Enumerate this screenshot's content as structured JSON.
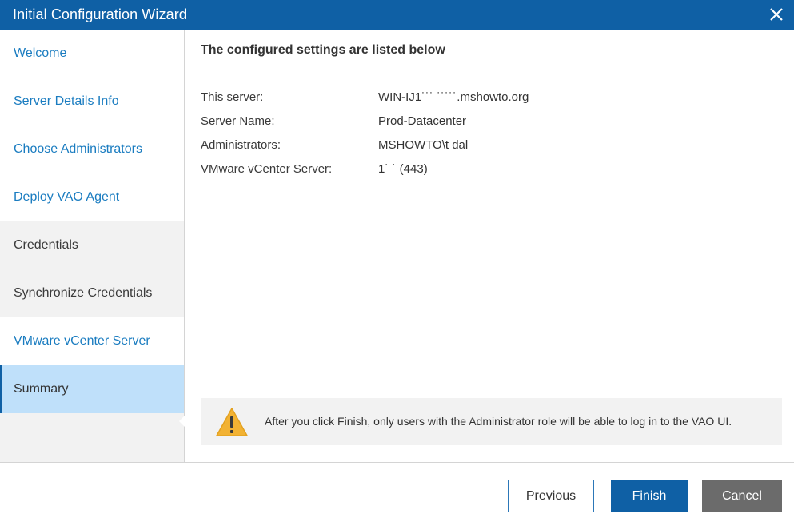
{
  "window": {
    "title": "Initial Configuration Wizard",
    "close_icon": "close-icon"
  },
  "sidebar": {
    "items": [
      {
        "label": "Welcome",
        "state": "done"
      },
      {
        "label": "Server Details Info",
        "state": "done"
      },
      {
        "label": "Choose Administrators",
        "state": "done"
      },
      {
        "label": "Deploy VAO Agent",
        "state": "done"
      },
      {
        "label": "Credentials",
        "state": "pending"
      },
      {
        "label": "Synchronize Credentials",
        "state": "pending"
      },
      {
        "label": "VMware vCenter Server",
        "state": "done"
      },
      {
        "label": "Summary",
        "state": "active"
      }
    ]
  },
  "main": {
    "heading": "The configured settings are listed below",
    "summary": [
      {
        "label": "This server:",
        "value": "WIN-IJ1˙˙˙ ˙˙˙˙˙.mshowto.org"
      },
      {
        "label": "Server Name:",
        "value": "Prod-Datacenter"
      },
      {
        "label": "Administrators:",
        "value": "MSHOWTO\\t      dal"
      },
      {
        "label": "VMware vCenter Server:",
        "value": "1˙                  ˙ (443)"
      }
    ],
    "warning": {
      "icon": "warning-icon",
      "text": "After you click Finish, only users with the Administrator role will be able to log in to the VAO UI."
    }
  },
  "footer": {
    "previous_label": "Previous",
    "finish_label": "Finish",
    "cancel_label": "Cancel"
  },
  "colors": {
    "title_bar": "#0f60a5",
    "active_step": "#bfe0fa",
    "completed_step_text": "#1a7cc0",
    "cancel_button": "#6b6b6b",
    "warning_icon": "#f2b233"
  }
}
